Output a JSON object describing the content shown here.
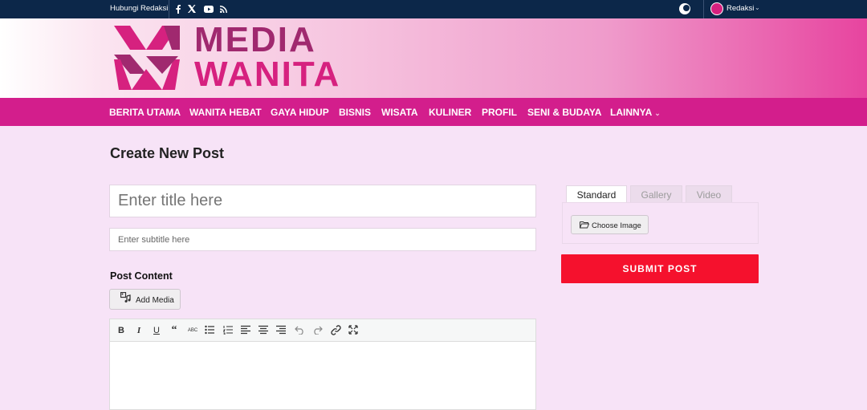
{
  "topbar": {
    "contact_label": "Hubungi Redaksi",
    "social_icons": [
      "facebook-icon",
      "x-icon",
      "youtube-icon",
      "rss-icon"
    ],
    "user_name": "Redaksi"
  },
  "brand": {
    "line1": "MEDIA",
    "line2": "WANITA",
    "colors": {
      "dark": "#a0296f",
      "bright": "#d6217f"
    }
  },
  "nav": {
    "items": [
      "BERITA UTAMA",
      "WANITA HEBAT",
      "GAYA HIDUP",
      "BISNIS",
      "WISATA",
      "KULINER",
      "PROFIL",
      "SENI & BUDAYA",
      "LAINNYA"
    ]
  },
  "form": {
    "page_title": "Create New Post",
    "title_placeholder": "Enter title here",
    "subtitle_placeholder": "Enter subtitle here",
    "content_label": "Post Content",
    "add_media_label": "Add Media",
    "toolbar": [
      "bold",
      "italic",
      "underline",
      "blockquote",
      "strikethrough",
      "bullet-list",
      "numbered-list",
      "align-left",
      "align-center",
      "align-right",
      "undo",
      "redo",
      "link",
      "fullscreen"
    ]
  },
  "sidebar": {
    "tabs": [
      "Standard",
      "Gallery",
      "Video"
    ],
    "active_tab": "Standard",
    "choose_image_label": "Choose Image",
    "submit_label": "SUBMIT POST"
  },
  "colors": {
    "topbar": "#0c2749",
    "nav": "#d31e8c",
    "page_bg": "#f7e3f7",
    "submit": "#f5112d"
  }
}
